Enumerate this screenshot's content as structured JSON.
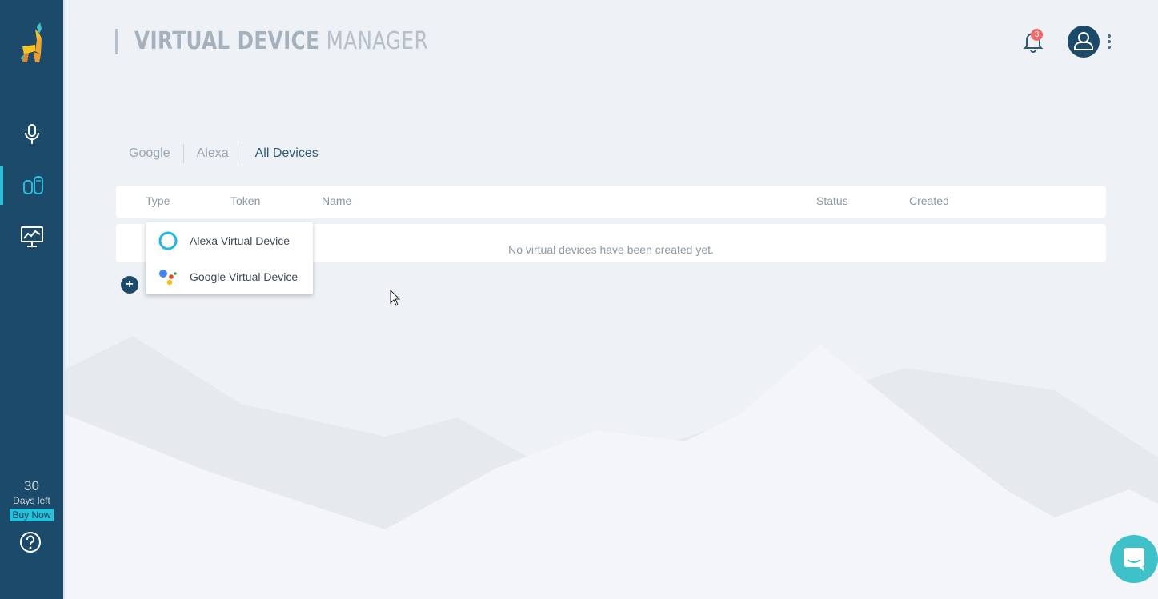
{
  "app": {
    "title_bold": "VIRTUAL DEVICE",
    "title_light": "MANAGER",
    "notification_count": "3"
  },
  "sidebar": {
    "items": [
      {
        "name": "voice",
        "icon": "microphone-icon"
      },
      {
        "name": "virtual-devices",
        "icon": "devices-icon",
        "active": true
      },
      {
        "name": "monitoring",
        "icon": "chart-monitor-icon"
      }
    ],
    "trial": {
      "days": "30",
      "days_label": "Days left",
      "buy_label": "Buy Now"
    },
    "help_icon": "question-circle-icon"
  },
  "tabs": [
    {
      "label": "Google"
    },
    {
      "label": "Alexa"
    },
    {
      "label": "All Devices",
      "active": true
    }
  ],
  "table": {
    "columns": [
      "Type",
      "Token",
      "Name",
      "Status",
      "Created"
    ],
    "empty_message": "No virtual devices have been created yet."
  },
  "dropdown": {
    "items": [
      {
        "label": "Alexa Virtual Device",
        "icon": "alexa-icon"
      },
      {
        "label": "Google Virtual Device",
        "icon": "google-assistant-icon"
      }
    ]
  },
  "colors": {
    "sidebar": "#1c4a6b",
    "accent": "#26c2dc",
    "background": "#eef1f5",
    "badge": "#f26a6a",
    "chat": "#3fc1c9"
  }
}
